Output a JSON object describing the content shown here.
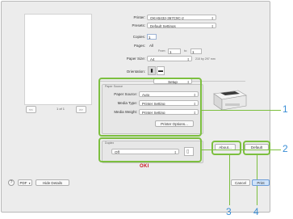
{
  "header": {
    "printer_label": "Printer:",
    "printer_value": "OKI-B432-367C9C-2",
    "presets_label": "Presets:",
    "presets_value": "Default Settings",
    "copies_label": "Copies:",
    "copies_value": "1",
    "pages_label": "Pages:",
    "pages_all": "All",
    "pages_from": "From:",
    "pages_from_value": "1",
    "pages_to": "to:",
    "pages_to_value": "1",
    "paper_size_label": "Paper Size:",
    "paper_size_value": "A4",
    "paper_size_dims": "210 by 297 mm",
    "orientation_label": "Orientation:",
    "setup_value": "Setup"
  },
  "preview": {
    "prev_label": "<<",
    "page_indicator": "1 of 1",
    "next_label": ">>"
  },
  "paper_source_group": {
    "title": "Paper Source",
    "source_label": "Paper Source:",
    "source_value": "Auto",
    "media_type_label": "Media Type:",
    "media_type_value": "Printer Setting",
    "media_weight_label": "Media Weight:",
    "media_weight_value": "Printer Setting",
    "printer_options_label": "Printer Options..."
  },
  "duplex_group": {
    "title": "Duplex",
    "value": "Off"
  },
  "brand": "OKI",
  "buttons": {
    "about": "About...",
    "default": "Default",
    "help": "?",
    "pdf": "PDF",
    "hide_details": "Hide Details",
    "cancel": "Cancel",
    "print": "Print"
  },
  "callouts": [
    "1",
    "2",
    "3",
    "4"
  ],
  "colors": {
    "highlight": "#7cbf3f",
    "callout_number": "#3a8ed6",
    "brand": "#c8141e"
  }
}
